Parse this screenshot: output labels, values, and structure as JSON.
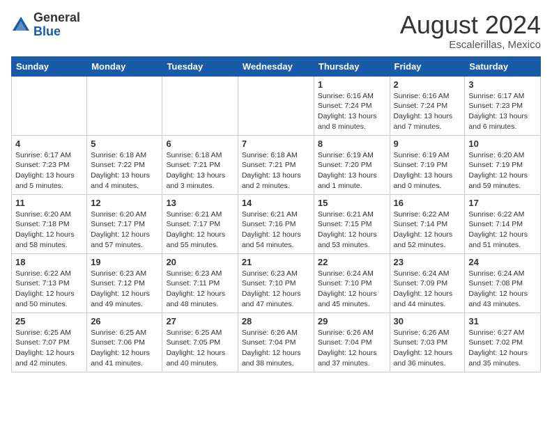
{
  "header": {
    "logo_general": "General",
    "logo_blue": "Blue",
    "month_year": "August 2024",
    "location": "Escalerillas, Mexico"
  },
  "weekdays": [
    "Sunday",
    "Monday",
    "Tuesday",
    "Wednesday",
    "Thursday",
    "Friday",
    "Saturday"
  ],
  "weeks": [
    [
      {
        "day": "",
        "info": ""
      },
      {
        "day": "",
        "info": ""
      },
      {
        "day": "",
        "info": ""
      },
      {
        "day": "",
        "info": ""
      },
      {
        "day": "1",
        "info": "Sunrise: 6:16 AM\nSunset: 7:24 PM\nDaylight: 13 hours\nand 8 minutes."
      },
      {
        "day": "2",
        "info": "Sunrise: 6:16 AM\nSunset: 7:24 PM\nDaylight: 13 hours\nand 7 minutes."
      },
      {
        "day": "3",
        "info": "Sunrise: 6:17 AM\nSunset: 7:23 PM\nDaylight: 13 hours\nand 6 minutes."
      }
    ],
    [
      {
        "day": "4",
        "info": "Sunrise: 6:17 AM\nSunset: 7:23 PM\nDaylight: 13 hours\nand 5 minutes."
      },
      {
        "day": "5",
        "info": "Sunrise: 6:18 AM\nSunset: 7:22 PM\nDaylight: 13 hours\nand 4 minutes."
      },
      {
        "day": "6",
        "info": "Sunrise: 6:18 AM\nSunset: 7:21 PM\nDaylight: 13 hours\nand 3 minutes."
      },
      {
        "day": "7",
        "info": "Sunrise: 6:18 AM\nSunset: 7:21 PM\nDaylight: 13 hours\nand 2 minutes."
      },
      {
        "day": "8",
        "info": "Sunrise: 6:19 AM\nSunset: 7:20 PM\nDaylight: 13 hours\nand 1 minute."
      },
      {
        "day": "9",
        "info": "Sunrise: 6:19 AM\nSunset: 7:19 PM\nDaylight: 13 hours\nand 0 minutes."
      },
      {
        "day": "10",
        "info": "Sunrise: 6:20 AM\nSunset: 7:19 PM\nDaylight: 12 hours\nand 59 minutes."
      }
    ],
    [
      {
        "day": "11",
        "info": "Sunrise: 6:20 AM\nSunset: 7:18 PM\nDaylight: 12 hours\nand 58 minutes."
      },
      {
        "day": "12",
        "info": "Sunrise: 6:20 AM\nSunset: 7:17 PM\nDaylight: 12 hours\nand 57 minutes."
      },
      {
        "day": "13",
        "info": "Sunrise: 6:21 AM\nSunset: 7:17 PM\nDaylight: 12 hours\nand 55 minutes."
      },
      {
        "day": "14",
        "info": "Sunrise: 6:21 AM\nSunset: 7:16 PM\nDaylight: 12 hours\nand 54 minutes."
      },
      {
        "day": "15",
        "info": "Sunrise: 6:21 AM\nSunset: 7:15 PM\nDaylight: 12 hours\nand 53 minutes."
      },
      {
        "day": "16",
        "info": "Sunrise: 6:22 AM\nSunset: 7:14 PM\nDaylight: 12 hours\nand 52 minutes."
      },
      {
        "day": "17",
        "info": "Sunrise: 6:22 AM\nSunset: 7:14 PM\nDaylight: 12 hours\nand 51 minutes."
      }
    ],
    [
      {
        "day": "18",
        "info": "Sunrise: 6:22 AM\nSunset: 7:13 PM\nDaylight: 12 hours\nand 50 minutes."
      },
      {
        "day": "19",
        "info": "Sunrise: 6:23 AM\nSunset: 7:12 PM\nDaylight: 12 hours\nand 49 minutes."
      },
      {
        "day": "20",
        "info": "Sunrise: 6:23 AM\nSunset: 7:11 PM\nDaylight: 12 hours\nand 48 minutes."
      },
      {
        "day": "21",
        "info": "Sunrise: 6:23 AM\nSunset: 7:10 PM\nDaylight: 12 hours\nand 47 minutes."
      },
      {
        "day": "22",
        "info": "Sunrise: 6:24 AM\nSunset: 7:10 PM\nDaylight: 12 hours\nand 45 minutes."
      },
      {
        "day": "23",
        "info": "Sunrise: 6:24 AM\nSunset: 7:09 PM\nDaylight: 12 hours\nand 44 minutes."
      },
      {
        "day": "24",
        "info": "Sunrise: 6:24 AM\nSunset: 7:08 PM\nDaylight: 12 hours\nand 43 minutes."
      }
    ],
    [
      {
        "day": "25",
        "info": "Sunrise: 6:25 AM\nSunset: 7:07 PM\nDaylight: 12 hours\nand 42 minutes."
      },
      {
        "day": "26",
        "info": "Sunrise: 6:25 AM\nSunset: 7:06 PM\nDaylight: 12 hours\nand 41 minutes."
      },
      {
        "day": "27",
        "info": "Sunrise: 6:25 AM\nSunset: 7:05 PM\nDaylight: 12 hours\nand 40 minutes."
      },
      {
        "day": "28",
        "info": "Sunrise: 6:26 AM\nSunset: 7:04 PM\nDaylight: 12 hours\nand 38 minutes."
      },
      {
        "day": "29",
        "info": "Sunrise: 6:26 AM\nSunset: 7:04 PM\nDaylight: 12 hours\nand 37 minutes."
      },
      {
        "day": "30",
        "info": "Sunrise: 6:26 AM\nSunset: 7:03 PM\nDaylight: 12 hours\nand 36 minutes."
      },
      {
        "day": "31",
        "info": "Sunrise: 6:27 AM\nSunset: 7:02 PM\nDaylight: 12 hours\nand 35 minutes."
      }
    ]
  ]
}
